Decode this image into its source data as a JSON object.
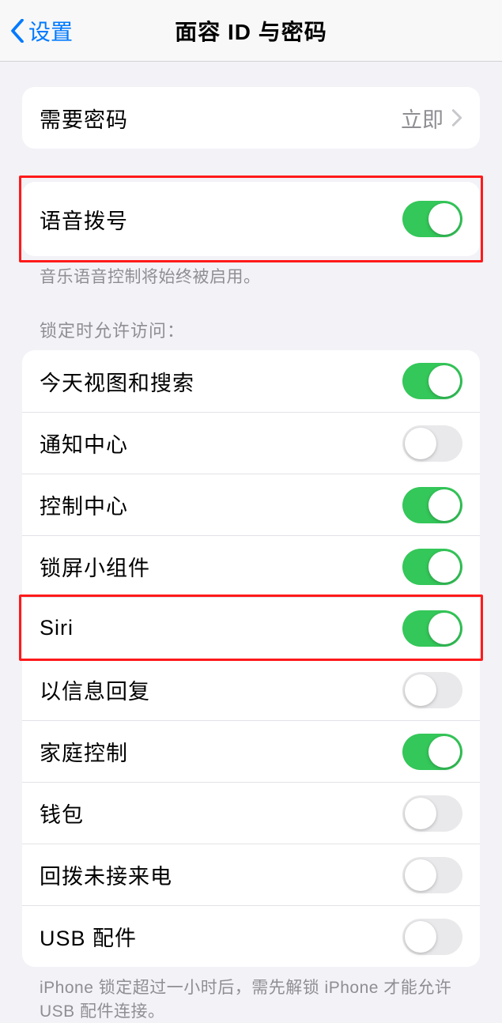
{
  "nav": {
    "back_label": "设置",
    "title": "面容 ID 与密码"
  },
  "require_passcode": {
    "label": "需要密码",
    "value": "立即"
  },
  "voice_dial": {
    "label": "语音拨号",
    "footer": "音乐语音控制将始终被启用。",
    "on": true
  },
  "lock_access_header": "锁定时允许访问：",
  "lock_access": {
    "items": [
      {
        "label": "今天视图和搜索",
        "on": true
      },
      {
        "label": "通知中心",
        "on": false
      },
      {
        "label": "控制中心",
        "on": true
      },
      {
        "label": "锁屏小组件",
        "on": true
      },
      {
        "label": "Siri",
        "on": true
      },
      {
        "label": "以信息回复",
        "on": false
      },
      {
        "label": "家庭控制",
        "on": true
      },
      {
        "label": "钱包",
        "on": false
      },
      {
        "label": "回拨未接来电",
        "on": false
      },
      {
        "label": "USB 配件",
        "on": false
      }
    ]
  },
  "usb_footer": "iPhone 锁定超过一小时后，需先解锁 iPhone 才能允许 USB 配件连接。",
  "highlighted_rows": [
    0,
    5
  ]
}
